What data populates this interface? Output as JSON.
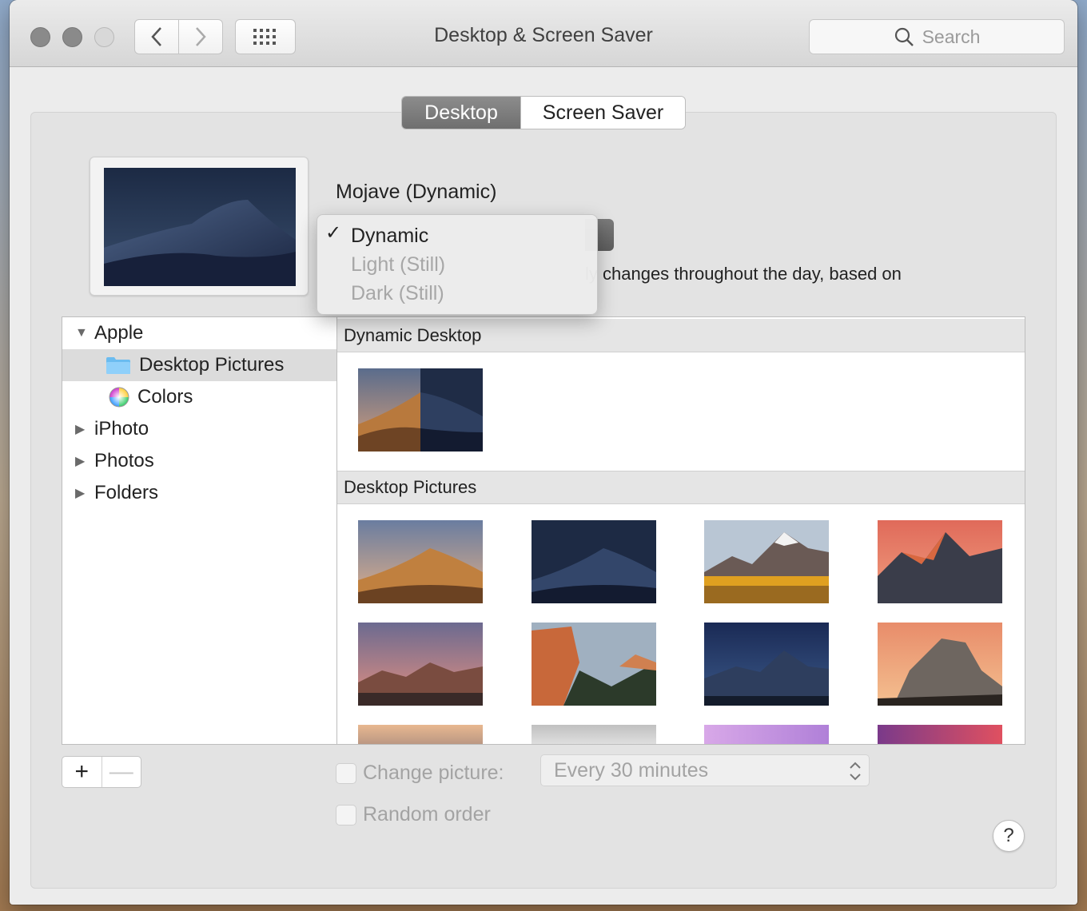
{
  "window": {
    "title": "Desktop & Screen Saver",
    "search_placeholder": "Search"
  },
  "tabs": [
    {
      "label": "Desktop",
      "active": true
    },
    {
      "label": "Screen Saver",
      "active": false
    }
  ],
  "wallpaper": {
    "name": "Mojave (Dynamic)",
    "description_fragment": "ly changes throughout the day, based on"
  },
  "appearance_menu": {
    "items": [
      {
        "label": "Dynamic",
        "checked": true,
        "enabled": true
      },
      {
        "label": "Light (Still)",
        "checked": false,
        "enabled": false
      },
      {
        "label": "Dark (Still)",
        "checked": false,
        "enabled": false
      }
    ]
  },
  "sidebar": {
    "items": [
      {
        "label": "Apple",
        "level": 0,
        "expanded": true
      },
      {
        "label": "Desktop Pictures",
        "level": 1,
        "selected": true,
        "icon": "folder-icon"
      },
      {
        "label": "Colors",
        "level": 1,
        "icon": "color-wheel-icon"
      },
      {
        "label": "iPhoto",
        "level": 0,
        "expanded": false
      },
      {
        "label": "Photos",
        "level": 0,
        "expanded": false
      },
      {
        "label": "Folders",
        "level": 0,
        "expanded": false
      }
    ]
  },
  "sections": {
    "dynamic_header": "Dynamic Desktop",
    "pictures_header": "Desktop Pictures"
  },
  "controls": {
    "plus": "+",
    "minus": "—",
    "change_picture_label": "Change picture:",
    "interval_value": "Every 30 minutes",
    "random_order_label": "Random order",
    "help": "?"
  },
  "colors": {
    "accent_active_tab": "#7a7a7a",
    "selection": "#dcdcdc",
    "folder": "#6bbcf0"
  }
}
